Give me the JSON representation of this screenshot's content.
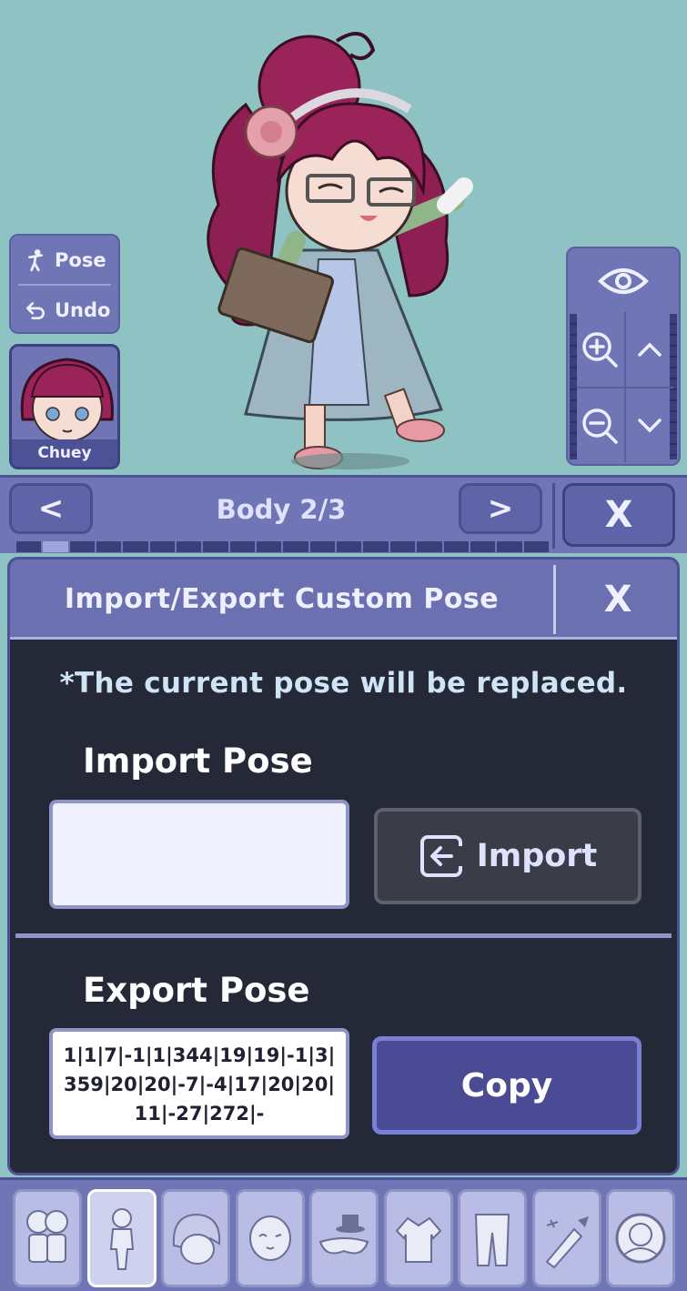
{
  "stage": {
    "pose_label": "Pose",
    "undo_label": "Undo",
    "character_name": "Chuey"
  },
  "category": {
    "title": "Body 2/3",
    "prev": "<",
    "next": ">",
    "close": "X",
    "progress_segments": 20,
    "progress_active_index": 2
  },
  "dialog": {
    "title": "Import/Export Custom Pose",
    "close": "X",
    "warning": "*The current pose will be replaced.",
    "import_heading": "Import Pose",
    "import_value": "",
    "import_button": "Import",
    "export_heading": "Export Pose",
    "export_value": "1|1|7|-1|1|344|19|19|-1|3|359|20|20|-7|-4|17|20|20|11|-27|272|-",
    "copy_button": "Copy"
  },
  "toolbar": {
    "items": [
      {
        "icon": "presets-icon"
      },
      {
        "icon": "body-icon",
        "active": true
      },
      {
        "icon": "hair-icon"
      },
      {
        "icon": "face-icon"
      },
      {
        "icon": "accessories-icon"
      },
      {
        "icon": "top-clothing-icon"
      },
      {
        "icon": "bottom-clothing-icon"
      },
      {
        "icon": "props-icon"
      },
      {
        "icon": "profile-icon"
      }
    ]
  },
  "colors": {
    "stage_bg": "#8ec2c3",
    "panel": "#6f75b5",
    "dialog_bg": "#252836",
    "copy_button": "#4a4b94"
  }
}
